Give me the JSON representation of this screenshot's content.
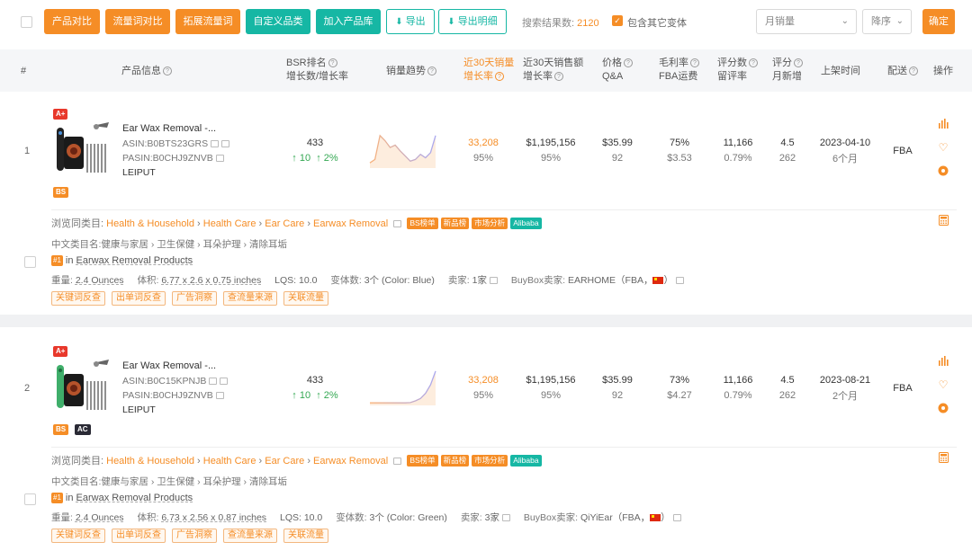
{
  "toolbar": {
    "buttons": [
      "产品对比",
      "流量词对比",
      "拓展流量词",
      "自定义品类",
      "加入产品库",
      "导出",
      "导出明细"
    ],
    "result_label": "搜索结果数:",
    "result_count": "2120",
    "variant_label": "包含其它变体",
    "variant_checked": true,
    "sort_field": "月销量",
    "sort_order": "降序",
    "confirm": "确定"
  },
  "columns": {
    "index": "#",
    "product": "产品信息",
    "bsr_1": "BSR排名",
    "bsr_2": "增长数/增长率",
    "trend": "销量趋势",
    "sales_1": "近30天销量",
    "sales_2": "增长率",
    "revenue_1": "近30天销售额",
    "revenue_2": "增长率",
    "price_1": "价格",
    "price_2": "Q&A",
    "margin_1": "毛利率",
    "margin_2": "FBA运费",
    "ratings_1": "评分数",
    "ratings_2": "留评率",
    "score_1": "评分",
    "score_2": "月新增",
    "listed": "上架时间",
    "delivery": "配送",
    "ops": "操作"
  },
  "rows": [
    {
      "index": "1",
      "badge_top": "A+",
      "badges_bottom": [
        "BS"
      ],
      "title": "Ear Wax Removal -...",
      "asin": "ASIN:B0BTS23GRS",
      "pasin": "PASIN:B0CHJ9ZNVB",
      "brand": "LEIPUT",
      "bsr": "433",
      "bsr_growth": "10",
      "bsr_rate": "2%",
      "sales": "33,208",
      "sales_rate": "95%",
      "revenue": "$1,195,156",
      "revenue_rate": "95%",
      "price": "$35.99",
      "qa": "92",
      "margin": "75%",
      "fba_fee": "$3.53",
      "ratings": "11,166",
      "review_rate": "0.79%",
      "score": "4.5",
      "monthly_new": "262",
      "listed": "2023-04-10",
      "listed_ago": "6个月",
      "delivery": "FBA",
      "trend": [
        0.1,
        0.2,
        0.9,
        0.75,
        0.55,
        0.62,
        0.45,
        0.3,
        0.15,
        0.2,
        0.35,
        0.25,
        0.4,
        0.9
      ],
      "browse_label": "浏览同类目:",
      "browse_path": [
        "Health & Household",
        "Health Care",
        "Ear Care",
        "Earwax Removal"
      ],
      "tags": [
        "BS榜单",
        "新品榜",
        "市场分析",
        "Alibaba"
      ],
      "cn_label": "中文类目名:",
      "cn_path": [
        "健康与家居",
        "卫生保健",
        "耳朵护理",
        "清除耳垢"
      ],
      "rank_badge": "#1",
      "rank_in": "in",
      "rank_cat": "Earwax Removal Products",
      "weight_label": "重量:",
      "weight": "2.4 Ounces",
      "volume_label": "体积:",
      "volume": "6.77 x 2.6 x 0.75 inches",
      "lqs": "LQS: 10.0",
      "variants_label": "变体数:",
      "variants": "3个 (Color: Blue)",
      "sellers_label": "卖家:",
      "sellers": "1家",
      "buybox_label": "BuyBox卖家:",
      "buybox": "EARHOME（FBA，",
      "buybox_end": "）",
      "links": [
        "关键词反查",
        "出单词反查",
        "广告洞察",
        "查流量来源",
        "关联流量"
      ]
    },
    {
      "index": "2",
      "badge_top": "A+",
      "badges_bottom": [
        "BS",
        "AC"
      ],
      "title": "Ear Wax Removal -...",
      "asin": "ASIN:B0C15KPNJB",
      "pasin": "PASIN:B0CHJ9ZNVB",
      "brand": "LEIPUT",
      "bsr": "433",
      "bsr_growth": "10",
      "bsr_rate": "2%",
      "sales": "33,208",
      "sales_rate": "95%",
      "revenue": "$1,195,156",
      "revenue_rate": "95%",
      "price": "$35.99",
      "qa": "92",
      "margin": "73%",
      "fba_fee": "$4.27",
      "ratings": "11,166",
      "review_rate": "0.79%",
      "score": "4.5",
      "monthly_new": "262",
      "listed": "2023-08-21",
      "listed_ago": "2个月",
      "delivery": "FBA",
      "trend": [
        0.02,
        0.02,
        0.02,
        0.02,
        0.02,
        0.02,
        0.02,
        0.02,
        0.03,
        0.08,
        0.15,
        0.3,
        0.55,
        0.95
      ],
      "browse_label": "浏览同类目:",
      "browse_path": [
        "Health & Household",
        "Health Care",
        "Ear Care",
        "Earwax Removal"
      ],
      "tags": [
        "BS榜单",
        "新品榜",
        "市场分析",
        "Alibaba"
      ],
      "cn_label": "中文类目名:",
      "cn_path": [
        "健康与家居",
        "卫生保健",
        "耳朵护理",
        "清除耳垢"
      ],
      "rank_badge": "#1",
      "rank_in": "in",
      "rank_cat": "Earwax Removal Products",
      "weight_label": "重量:",
      "weight": "2.4 Ounces",
      "volume_label": "体积:",
      "volume": "6.73 x 2.56 x 0.87 inches",
      "lqs": "LQS: 10.0",
      "variants_label": "变体数:",
      "variants": "3个 (Color: Green)",
      "sellers_label": "卖家:",
      "sellers": "3家",
      "buybox_label": "BuyBox卖家:",
      "buybox": "QiYiEar（FBA，",
      "buybox_end": "）",
      "links": [
        "关键词反查",
        "出单词反查",
        "广告洞察",
        "查流量来源",
        "关联流量"
      ]
    }
  ],
  "colors": {
    "accent": "#f58d26",
    "teal": "#16b7a4",
    "up": "#34a853"
  }
}
